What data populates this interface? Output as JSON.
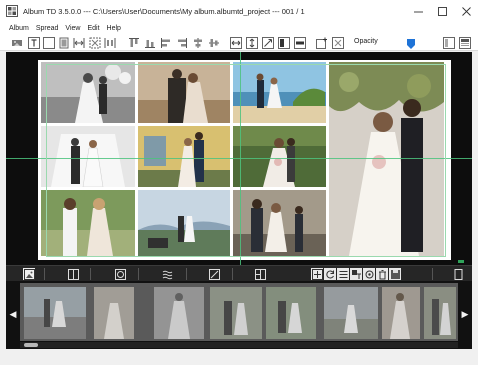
{
  "window": {
    "title": "Album TD 3.5.0.0 --- C:\\Users\\User\\Documents\\My album.albumtd_project --- 001 / 1",
    "controls": [
      "minimize",
      "maximize",
      "close"
    ]
  },
  "menu": [
    "Album",
    "Spread",
    "View",
    "Edit",
    "Help"
  ],
  "toolbar": {
    "opacity_label": "Opacity",
    "opacity_value": 0.5,
    "accent": "#1e73d7",
    "tools": [
      "image-frame-icon",
      "text-frame-icon",
      "rect-frame-icon",
      "fit-width-icon",
      "fit-height-icon",
      "fill-frame-icon",
      "distribute-icon",
      "align-top-icon",
      "align-middle-icon",
      "align-bottom-icon",
      "align-left-icon",
      "align-center-icon",
      "align-right-icon",
      "stretch-h-icon",
      "stretch-v-icon",
      "resize-icon",
      "split-icon",
      "bar-icon",
      "add-frame-icon",
      "remove-frame-icon",
      "panel-left-icon",
      "panel-right-icon"
    ]
  },
  "spread": {
    "background": "#ffffff",
    "guide_color": "#4cc37e",
    "photos": [
      {
        "id": "couple-balloons"
      },
      {
        "id": "couple-autumn-field"
      },
      {
        "id": "couple-beach"
      },
      {
        "id": "couple-tent-arch"
      },
      {
        "id": "couple-yellow-house"
      },
      {
        "id": "bride-bouquet-forest"
      },
      {
        "id": "couple-forest-path"
      },
      {
        "id": "couple-sunset"
      },
      {
        "id": "couple-vintage-car"
      },
      {
        "id": "couple-garden-kiss"
      }
    ]
  },
  "toolstrip": {
    "left_tools": [
      "image-tool-icon",
      "layout-tool-icon",
      "circle-tool-icon",
      "texture-tool-icon",
      "rotate-tool-icon",
      "grid-tool-icon"
    ],
    "right_tools": [
      "spread-add-icon",
      "spread-rotate-icon",
      "spread-list-icon",
      "spread-text-icon",
      "spread-settings-icon",
      "spread-delete-icon",
      "spread-save-icon"
    ],
    "far_right": "page-view-icon"
  },
  "filmstrip": {
    "thumbs": [
      "thumb-1",
      "thumb-2",
      "thumb-3",
      "thumb-4",
      "thumb-5",
      "thumb-6",
      "thumb-7",
      "thumb-8"
    ]
  }
}
